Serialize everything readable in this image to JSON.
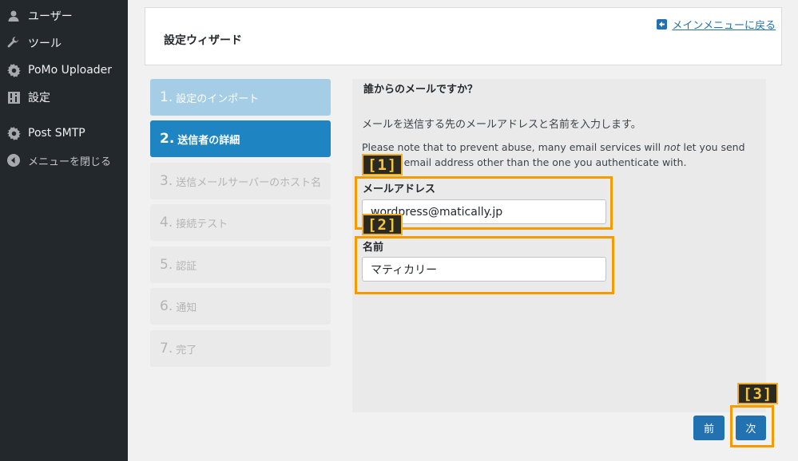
{
  "sidebar": {
    "items": [
      {
        "label": "ユーザー",
        "icon": "user-icon"
      },
      {
        "label": "ツール",
        "icon": "wrench-icon"
      },
      {
        "label": "PoMo Uploader",
        "icon": "gear-icon"
      },
      {
        "label": "設定",
        "icon": "settings-grid-icon"
      },
      {
        "label": "Post SMTP",
        "icon": "gear-icon"
      },
      {
        "label": "メニューを閉じる",
        "icon": "collapse-arrow-icon"
      }
    ]
  },
  "header": {
    "title": "設定ウィザード",
    "back_link": "メインメニューに戻る"
  },
  "steps": [
    {
      "num": "1.",
      "label": "設定のインポート",
      "state": "done"
    },
    {
      "num": "2.",
      "label": "送信者の詳細",
      "state": "active"
    },
    {
      "num": "3.",
      "label": "送信メールサーバーのホスト名",
      "state": "future"
    },
    {
      "num": "4.",
      "label": "接続テスト",
      "state": "future"
    },
    {
      "num": "5.",
      "label": "認証",
      "state": "future"
    },
    {
      "num": "6.",
      "label": "通知",
      "state": "future"
    },
    {
      "num": "7.",
      "label": "完了",
      "state": "future"
    }
  ],
  "content": {
    "question": "誰からのメールですか？",
    "description": "メールを送信する先のメールアドレスと名前を入力します。",
    "note_before": "Please note that to prevent abuse, many email services will ",
    "note_emph": "not",
    "note_after": " let you send from an email address other than the one you authenticate with.",
    "email_label": "メールアドレス",
    "email_value": "wordpress@matically.jp",
    "name_label": "名前",
    "name_value": "マティカリー"
  },
  "buttons": {
    "prev": "前",
    "next": "次"
  },
  "annotations": {
    "tag1": "[1]",
    "tag2": "[2]",
    "tag3": "[3]"
  },
  "colors": {
    "accent": "#2271b1",
    "active_step": "#1e85c2",
    "done_step": "#a5cde5",
    "highlight": "#f59b00"
  }
}
